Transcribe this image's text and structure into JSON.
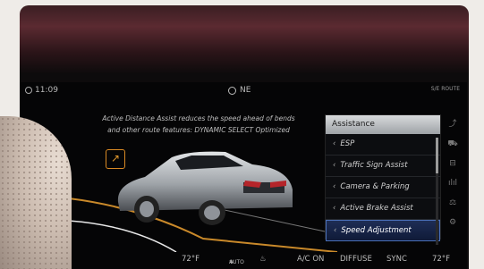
{
  "status_bar": {
    "time": "11:09",
    "heading": "NE",
    "right_indicator": "S/E ROUTE"
  },
  "message": {
    "line1": "Active Distance Assist reduces the speed ahead of bends",
    "line2": "and other route features: DYNAMIC SELECT Optimized"
  },
  "menu": {
    "title": "Assistance",
    "items": [
      {
        "label": "ESP"
      },
      {
        "label": "Traffic Sign Assist"
      },
      {
        "label": "Camera & Parking"
      },
      {
        "label": "Active Brake Assist"
      },
      {
        "label": "Speed Adjustment"
      }
    ],
    "selected": "Speed Adjustment"
  },
  "side_icons": [
    "seat-belt-icon",
    "car-front-icon",
    "car-side-icon",
    "bars-icon",
    "scale-icon",
    "settings-icon"
  ],
  "climate": {
    "left_temp": "72°F",
    "fan": "AUTO",
    "ac": "A/C ON",
    "diffuse": "DIFFUSE",
    "sync": "SYNC",
    "right_temp": "72°F"
  },
  "colors": {
    "accent": "#e49a2e",
    "selection": "#1e2d55"
  }
}
